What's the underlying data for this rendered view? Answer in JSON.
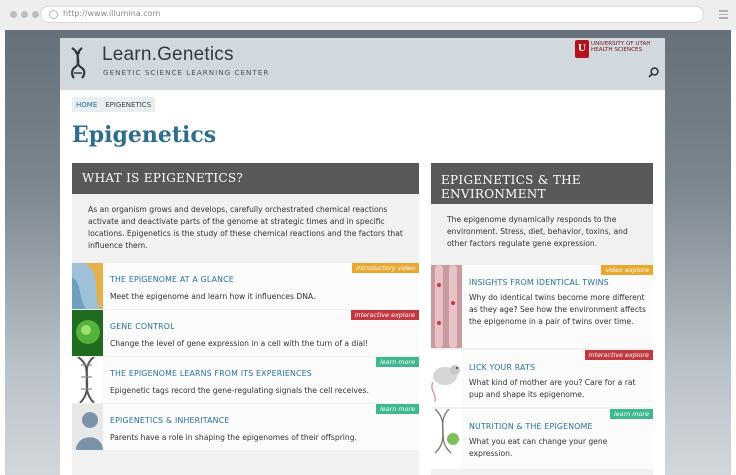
{
  "browser": {
    "url": "http://www.illumina.com"
  },
  "site": {
    "title": "Learn.Genetics",
    "subtitle": "GENETIC SCIENCE LEARNING CENTER",
    "university_line1": "UNIVERSITY OF UTAH",
    "university_line2": "HEALTH SCIENCES"
  },
  "breadcrumb": {
    "home": "HOME",
    "current": "EPIGENETICS"
  },
  "page": {
    "title": "Epigenetics"
  },
  "left_column": {
    "heading": "WHAT IS EPIGENETICS?",
    "intro": "As an organism grows and develops, carefully orchestrated chemical reactions activate and deactivate parts of the genome at strategic times and in specific locations. Epigenetics is the study of these chemical reactions and the factors that influence them.",
    "items": [
      {
        "title": "THE EPIGENOME AT A GLANCE",
        "desc": "Meet the epigenome and learn how it influences DNA.",
        "tag": "introductory video",
        "tag_color": "#e8a830"
      },
      {
        "title": "GENE CONTROL",
        "desc": "Change the level of gene expression in a cell with the turn of a dial!",
        "tag": "interactive explore",
        "tag_color": "#c2383f"
      },
      {
        "title": "THE EPIGENOME LEARNS FROM ITS EXPERIENCES",
        "desc": "Epigenetic tags record the gene-regulating signals the cell receives.",
        "tag": "learn more",
        "tag_color": "#3fb890"
      },
      {
        "title": "EPIGENETICS & INHERITANCE",
        "desc": "Parents have a role in shaping the epigenomes of their offspring.",
        "tag": "learn more",
        "tag_color": "#3fb890"
      }
    ]
  },
  "right_column": {
    "heading_line1": "EPIGENETICS & THE",
    "heading_line2": "ENVIRONMENT",
    "intro": "The epigenome dynamically responds to the environment. Stress, diet, behavior, toxins, and other factors regulate gene expression.",
    "items": [
      {
        "title": "INSIGHTS FROM IDENTICAL TWINS",
        "desc": "Why do identical twins become more different as they age? See how the environment affects the epigenome in a pair of twins over time.",
        "tag": "video explore",
        "tag_color": "#e8a830"
      },
      {
        "title": "LICK YOUR RATS",
        "desc": "What kind of mother are you? Care for a rat pup and shape its epigenome.",
        "tag": "interactive explore",
        "tag_color": "#c2383f"
      },
      {
        "title": "NUTRITION & THE EPIGENOME",
        "desc": "What you eat can change your gene expression.",
        "tag": "learn more",
        "tag_color": "#3fb890"
      }
    ]
  }
}
